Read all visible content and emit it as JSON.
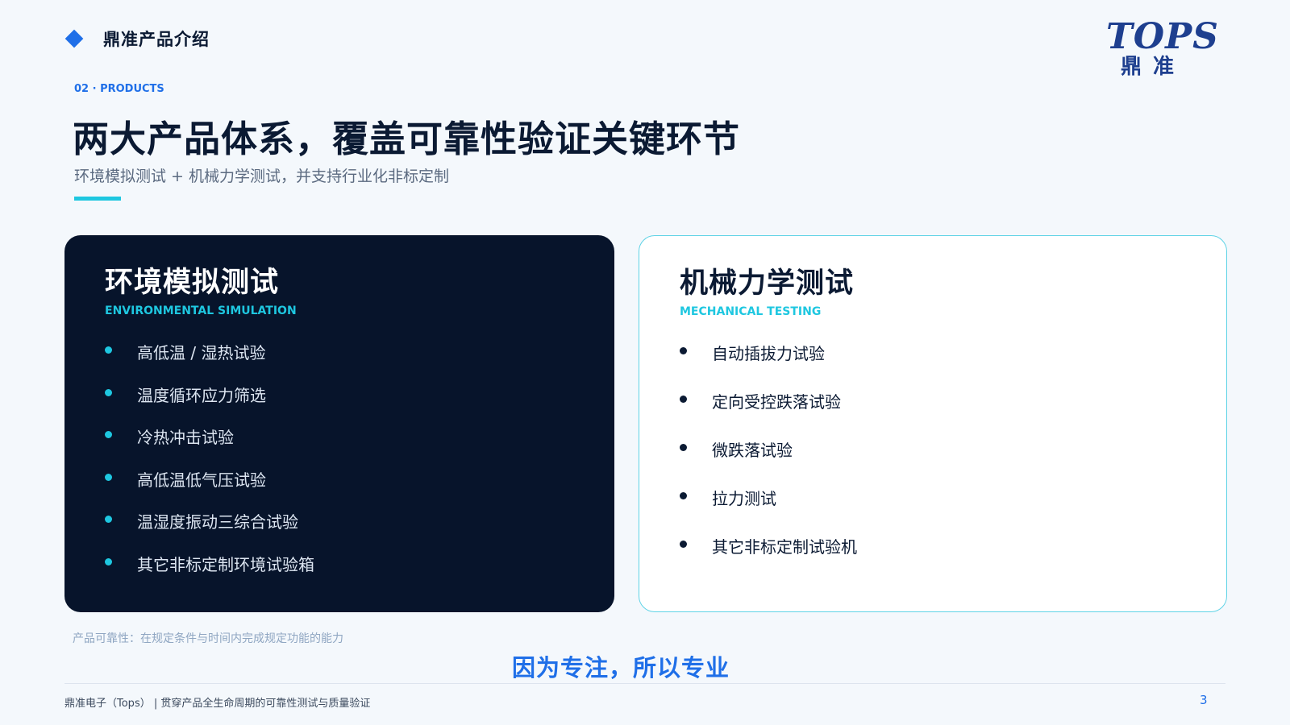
{
  "header": {
    "section_title": "鼎准产品介绍",
    "logo_top": "TOPS",
    "logo_bottom": "鼎准"
  },
  "intro": {
    "kicker": "02 · PRODUCTS",
    "headline": "两大产品体系，覆盖可靠性验证关键环节",
    "subline": "环境模拟测试 + 机械力学测试，并支持行业化非标定制"
  },
  "cards": [
    {
      "title": "环境模拟测试",
      "subtitle": "ENVIRONMENTAL SIMULATION",
      "items": [
        "高低温 / 湿热试验",
        "温度循环应力筛选",
        "冷热冲击试验",
        "高低温低气压试验",
        "温湿度振动三综合试验",
        "其它非标定制环境试验箱"
      ]
    },
    {
      "title": "机械力学测试",
      "subtitle": "MECHANICAL TESTING",
      "items": [
        "自动插拔力试验",
        "定向受控跌落试验",
        "微跌落试验",
        "拉力测试",
        "其它非标定制试验机"
      ]
    }
  ],
  "note": "产品可靠性：在规定条件与时间内完成规定功能的能力",
  "slogan": "因为专注，所以专业",
  "footer": {
    "text": "鼎准电子（Tops） | 贯穿产品全生命周期的可靠性测试与质量验证",
    "page_number": "3"
  },
  "colors": {
    "accent_blue": "#1f6fe8",
    "accent_cyan": "#1ec7e0",
    "dark_card": "#07142b",
    "background": "#f4f8fc"
  }
}
